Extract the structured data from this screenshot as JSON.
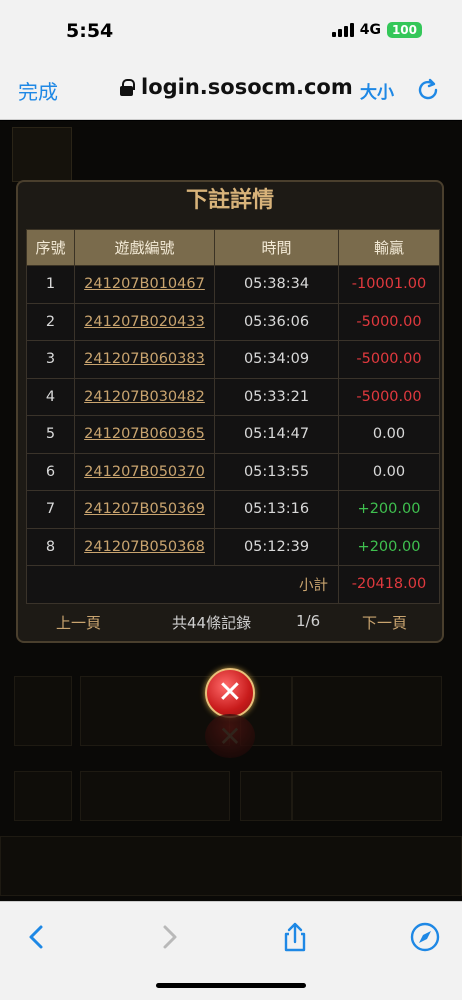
{
  "status_bar": {
    "time": "5:54",
    "network": "4G",
    "battery": "100"
  },
  "browser": {
    "done_label": "完成",
    "url": "login.sosocm.com",
    "text_size_label": "大小"
  },
  "modal": {
    "title": "下註詳情",
    "columns": [
      "序號",
      "遊戲編號",
      "時間",
      "輸贏"
    ],
    "rows": [
      {
        "no": "1",
        "game_id": "241207B010467",
        "time": "05:38:34",
        "result": "-10001.00"
      },
      {
        "no": "2",
        "game_id": "241207B020433",
        "time": "05:36:06",
        "result": "-5000.00"
      },
      {
        "no": "3",
        "game_id": "241207B060383",
        "time": "05:34:09",
        "result": "-5000.00"
      },
      {
        "no": "4",
        "game_id": "241207B030482",
        "time": "05:33:21",
        "result": "-5000.00"
      },
      {
        "no": "5",
        "game_id": "241207B060365",
        "time": "05:14:47",
        "result": "0.00"
      },
      {
        "no": "6",
        "game_id": "241207B050370",
        "time": "05:13:55",
        "result": "0.00"
      },
      {
        "no": "7",
        "game_id": "241207B050369",
        "time": "05:13:16",
        "result": "+200.00"
      },
      {
        "no": "8",
        "game_id": "241207B050368",
        "time": "05:12:39",
        "result": "+200.00"
      }
    ],
    "subtotal_label": "小計",
    "subtotal_value": "-20418.00",
    "pager": {
      "prev": "上一頁",
      "total_records": "共44條記錄",
      "page": "1/6",
      "next": "下一頁"
    }
  },
  "colors": {
    "accent": "#c9a46f",
    "negative": "#e0393e",
    "positive": "#3fc04f",
    "header_bg": "#7a6b4c"
  }
}
